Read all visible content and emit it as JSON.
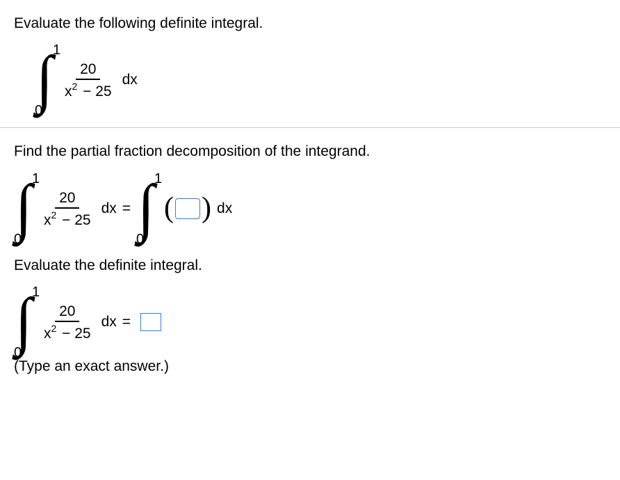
{
  "problem": {
    "title_instruction": "Evaluate the following definite integral.",
    "integral": {
      "lower": "0",
      "upper": "1",
      "numerator": "20",
      "denom_var": "x",
      "denom_exp": "2",
      "denom_const": " − 25",
      "dx": "dx"
    }
  },
  "part1": {
    "instruction": "Find the partial fraction decomposition of the integrand.",
    "lhs": {
      "lower": "0",
      "upper": "1",
      "numerator": "20",
      "denom_var": "x",
      "denom_exp": "2",
      "denom_const": " − 25",
      "dx": "dx"
    },
    "eq": "=",
    "rhs": {
      "lower": "0",
      "upper": "1",
      "dx": "dx"
    }
  },
  "part2": {
    "instruction": "Evaluate the definite integral.",
    "lhs": {
      "lower": "0",
      "upper": "1",
      "numerator": "20",
      "denom_var": "x",
      "denom_exp": "2",
      "denom_const": " − 25",
      "dx": "dx"
    },
    "eq": "=",
    "hint": "(Type an exact answer.)"
  }
}
